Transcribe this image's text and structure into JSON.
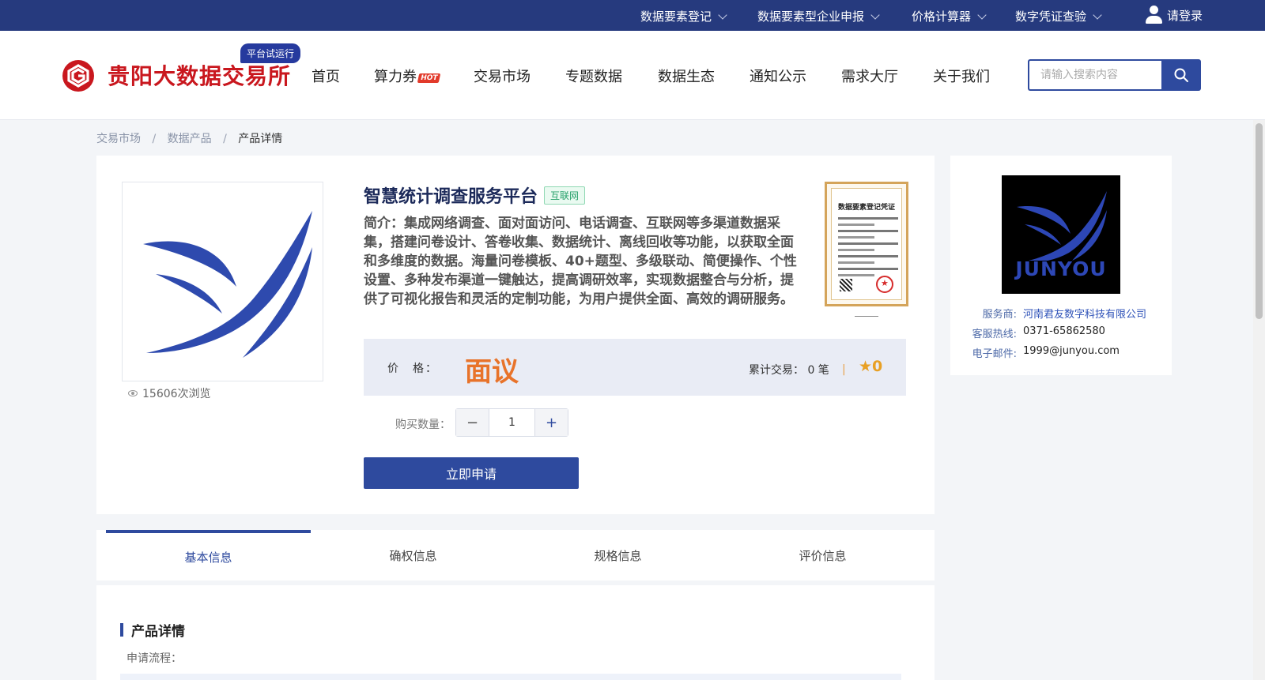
{
  "topbar": {
    "items": [
      {
        "label": "数据要素登记"
      },
      {
        "label": "数据要素型企业申报"
      },
      {
        "label": "价格计算器"
      },
      {
        "label": "数字凭证查验"
      }
    ],
    "login_label": "请登录"
  },
  "header": {
    "logo_text": "贵阳大数据交易所",
    "trial_badge": "平台试运行",
    "nav": [
      "首页",
      "算力券",
      "交易市场",
      "专题数据",
      "数据生态",
      "通知公示",
      "需求大厅",
      "关于我们"
    ],
    "hot_tag": "HOT",
    "search_placeholder": "请输入搜索内容"
  },
  "breadcrumb": {
    "items": [
      "交易市场",
      "数据产品"
    ],
    "separator": "/",
    "current": "产品详情"
  },
  "product": {
    "title": "智慧统计调查服务平台",
    "tag": "互联网",
    "description": "简介：集成网络调查、面对面访问、电话调查、互联网等多渠道数据采集，搭建问卷设计、答卷收集、数据统计、离线回收等功能，以获取全面和多维度的数据。海量问卷模板、40+题型、多级联动、简便操作、个性设置、多种发布渠道一键触达，提高调研效率，实现数据整合与分析，提供了可视化报告和灵活的定制功能，为用户提供全面、高效的调研服务。",
    "views_text": "15606次浏览",
    "certificate_title": "数据要素登记凭证",
    "price_label": "价　格：",
    "price_value": "面议",
    "trade_count": "累计交易：  0 笔",
    "divider": "|",
    "rating": "0",
    "qty_label": "购买数量：",
    "qty_minus": "−",
    "qty_value": "1",
    "qty_plus": "+",
    "apply_button": "立即申请"
  },
  "provider": {
    "logo_text": "JUNYOU",
    "rows": [
      {
        "key": "服务商:",
        "value": "河南君友数字科技有限公司"
      },
      {
        "key": "客服热线:",
        "value": "0371-65862580"
      },
      {
        "key": "电子邮件:",
        "value": "1999@junyou.com"
      }
    ]
  },
  "tabs": [
    "基本信息",
    "确权信息",
    "规格信息",
    "评价信息"
  ],
  "detail": {
    "title": "产品详情",
    "subtitle": "申请流程："
  },
  "colors": {
    "topbar": "#263a7e",
    "brand_red": "#c9171e",
    "primary": "#2e4a9e",
    "price_orange": "#e8732a"
  }
}
